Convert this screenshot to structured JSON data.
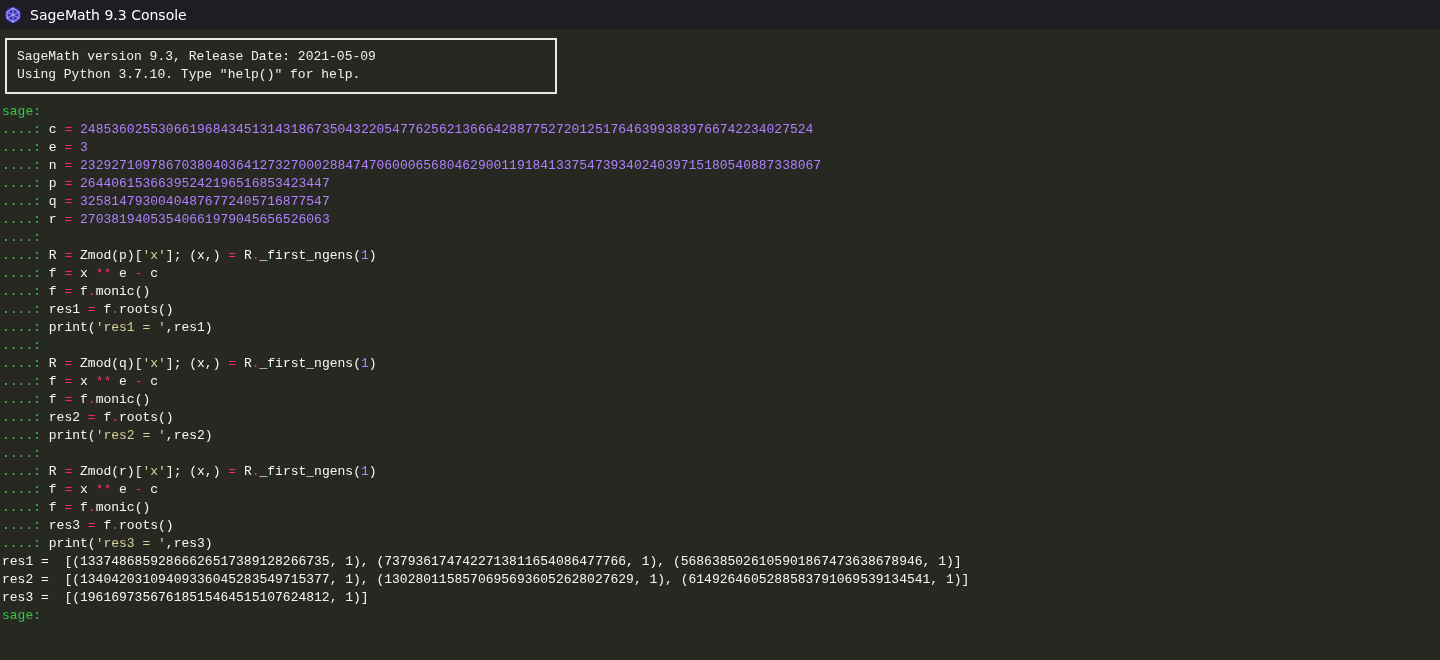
{
  "window": {
    "title": "SageMath 9.3 Console"
  },
  "banner": [
    "SageMath version 9.3, Release Date: 2021-05-09",
    "Using Python 3.7.10. Type \"help()\" for help."
  ],
  "lines": [
    {
      "kind": "input",
      "prompt": "sage:"
    },
    {
      "kind": "input",
      "prompt": "....:",
      "tokens": [
        {
          "kind": "id",
          "text": "c "
        },
        {
          "kind": "op",
          "text": "="
        },
        {
          "kind": "num",
          "text": " 2485360255306619684345131431867350432205477625621366642887752720125176463993839766742234027524"
        }
      ]
    },
    {
      "kind": "input",
      "prompt": "....:",
      "tokens": [
        {
          "kind": "id",
          "text": "e "
        },
        {
          "kind": "op",
          "text": "="
        },
        {
          "kind": "num",
          "text": " 3"
        }
      ]
    },
    {
      "kind": "input",
      "prompt": "....:",
      "tokens": [
        {
          "kind": "id",
          "text": "n "
        },
        {
          "kind": "op",
          "text": "="
        },
        {
          "kind": "num",
          "text": " 23292710978670380403641273270002884747060006568046290011918413375473934024039715180540887338067"
        }
      ]
    },
    {
      "kind": "input",
      "prompt": "....:",
      "tokens": [
        {
          "kind": "id",
          "text": "p "
        },
        {
          "kind": "op",
          "text": "="
        },
        {
          "kind": "num",
          "text": " 26440615366395242196516853423447"
        }
      ]
    },
    {
      "kind": "input",
      "prompt": "....:",
      "tokens": [
        {
          "kind": "id",
          "text": "q "
        },
        {
          "kind": "op",
          "text": "="
        },
        {
          "kind": "num",
          "text": " 32581479300404876772405716877547"
        }
      ]
    },
    {
      "kind": "input",
      "prompt": "....:",
      "tokens": [
        {
          "kind": "id",
          "text": "r "
        },
        {
          "kind": "op",
          "text": "="
        },
        {
          "kind": "num",
          "text": " 27038194053540661979045656526063"
        }
      ]
    },
    {
      "kind": "input",
      "prompt": "....:"
    },
    {
      "kind": "input",
      "prompt": "....:",
      "tokens": [
        {
          "kind": "id",
          "text": "R "
        },
        {
          "kind": "op",
          "text": "="
        },
        {
          "kind": "id",
          "text": " Zmod(p)["
        },
        {
          "kind": "str",
          "text": "'x'"
        },
        {
          "kind": "id",
          "text": "]; (x,) "
        },
        {
          "kind": "op",
          "text": "="
        },
        {
          "kind": "id",
          "text": " R"
        },
        {
          "kind": "op",
          "text": "."
        },
        {
          "kind": "id",
          "text": "_first_ngens("
        },
        {
          "kind": "num",
          "text": "1"
        },
        {
          "kind": "id",
          "text": ")"
        }
      ]
    },
    {
      "kind": "input",
      "prompt": "....:",
      "tokens": [
        {
          "kind": "id",
          "text": "f "
        },
        {
          "kind": "op",
          "text": "="
        },
        {
          "kind": "id",
          "text": " x "
        },
        {
          "kind": "op",
          "text": "**"
        },
        {
          "kind": "id",
          "text": " e "
        },
        {
          "kind": "op",
          "text": "-"
        },
        {
          "kind": "id",
          "text": " c"
        }
      ]
    },
    {
      "kind": "input",
      "prompt": "....:",
      "tokens": [
        {
          "kind": "id",
          "text": "f "
        },
        {
          "kind": "op",
          "text": "="
        },
        {
          "kind": "id",
          "text": " f"
        },
        {
          "kind": "op",
          "text": "."
        },
        {
          "kind": "id",
          "text": "monic()"
        }
      ]
    },
    {
      "kind": "input",
      "prompt": "....:",
      "tokens": [
        {
          "kind": "id",
          "text": "res1 "
        },
        {
          "kind": "op",
          "text": "="
        },
        {
          "kind": "id",
          "text": " f"
        },
        {
          "kind": "op",
          "text": "."
        },
        {
          "kind": "id",
          "text": "roots()"
        }
      ]
    },
    {
      "kind": "input",
      "prompt": "....:",
      "tokens": [
        {
          "kind": "id",
          "text": "print("
        },
        {
          "kind": "str",
          "text": "'res1 = '"
        },
        {
          "kind": "id",
          "text": ",res1)"
        }
      ]
    },
    {
      "kind": "input",
      "prompt": "....:"
    },
    {
      "kind": "input",
      "prompt": "....:",
      "tokens": [
        {
          "kind": "id",
          "text": "R "
        },
        {
          "kind": "op",
          "text": "="
        },
        {
          "kind": "id",
          "text": " Zmod(q)["
        },
        {
          "kind": "str",
          "text": "'x'"
        },
        {
          "kind": "id",
          "text": "]; (x,) "
        },
        {
          "kind": "op",
          "text": "="
        },
        {
          "kind": "id",
          "text": " R"
        },
        {
          "kind": "op",
          "text": "."
        },
        {
          "kind": "id",
          "text": "_first_ngens("
        },
        {
          "kind": "num",
          "text": "1"
        },
        {
          "kind": "id",
          "text": ")"
        }
      ]
    },
    {
      "kind": "input",
      "prompt": "....:",
      "tokens": [
        {
          "kind": "id",
          "text": "f "
        },
        {
          "kind": "op",
          "text": "="
        },
        {
          "kind": "id",
          "text": " x "
        },
        {
          "kind": "op",
          "text": "**"
        },
        {
          "kind": "id",
          "text": " e "
        },
        {
          "kind": "op",
          "text": "-"
        },
        {
          "kind": "id",
          "text": " c"
        }
      ]
    },
    {
      "kind": "input",
      "prompt": "....:",
      "tokens": [
        {
          "kind": "id",
          "text": "f "
        },
        {
          "kind": "op",
          "text": "="
        },
        {
          "kind": "id",
          "text": " f"
        },
        {
          "kind": "op",
          "text": "."
        },
        {
          "kind": "id",
          "text": "monic()"
        }
      ]
    },
    {
      "kind": "input",
      "prompt": "....:",
      "tokens": [
        {
          "kind": "id",
          "text": "res2 "
        },
        {
          "kind": "op",
          "text": "="
        },
        {
          "kind": "id",
          "text": " f"
        },
        {
          "kind": "op",
          "text": "."
        },
        {
          "kind": "id",
          "text": "roots()"
        }
      ]
    },
    {
      "kind": "input",
      "prompt": "....:",
      "tokens": [
        {
          "kind": "id",
          "text": "print("
        },
        {
          "kind": "str",
          "text": "'res2 = '"
        },
        {
          "kind": "id",
          "text": ",res2)"
        }
      ]
    },
    {
      "kind": "input",
      "prompt": "....:"
    },
    {
      "kind": "input",
      "prompt": "....:",
      "tokens": [
        {
          "kind": "id",
          "text": "R "
        },
        {
          "kind": "op",
          "text": "="
        },
        {
          "kind": "id",
          "text": " Zmod(r)["
        },
        {
          "kind": "str",
          "text": "'x'"
        },
        {
          "kind": "id",
          "text": "]; (x,) "
        },
        {
          "kind": "op",
          "text": "="
        },
        {
          "kind": "id",
          "text": " R"
        },
        {
          "kind": "op",
          "text": "."
        },
        {
          "kind": "id",
          "text": "_first_ngens("
        },
        {
          "kind": "num",
          "text": "1"
        },
        {
          "kind": "id",
          "text": ")"
        }
      ]
    },
    {
      "kind": "input",
      "prompt": "....:",
      "tokens": [
        {
          "kind": "id",
          "text": "f "
        },
        {
          "kind": "op",
          "text": "="
        },
        {
          "kind": "id",
          "text": " x "
        },
        {
          "kind": "op",
          "text": "**"
        },
        {
          "kind": "id",
          "text": " e "
        },
        {
          "kind": "op",
          "text": "-"
        },
        {
          "kind": "id",
          "text": " c"
        }
      ]
    },
    {
      "kind": "input",
      "prompt": "....:",
      "tokens": [
        {
          "kind": "id",
          "text": "f "
        },
        {
          "kind": "op",
          "text": "="
        },
        {
          "kind": "id",
          "text": " f"
        },
        {
          "kind": "op",
          "text": "."
        },
        {
          "kind": "id",
          "text": "monic()"
        }
      ]
    },
    {
      "kind": "input",
      "prompt": "....:",
      "tokens": [
        {
          "kind": "id",
          "text": "res3 "
        },
        {
          "kind": "op",
          "text": "="
        },
        {
          "kind": "id",
          "text": " f"
        },
        {
          "kind": "op",
          "text": "."
        },
        {
          "kind": "id",
          "text": "roots()"
        }
      ]
    },
    {
      "kind": "input",
      "prompt": "....:",
      "tokens": [
        {
          "kind": "id",
          "text": "print("
        },
        {
          "kind": "str",
          "text": "'res3 = '"
        },
        {
          "kind": "id",
          "text": ",res3)"
        }
      ]
    },
    {
      "kind": "output",
      "text": "res1 =  [(13374868592866626517389128266735, 1), (7379361747422713811654086477766, 1), (5686385026105901867473638678946, 1)]"
    },
    {
      "kind": "output",
      "text": "res2 =  [(13404203109409336045283549715377, 1), (13028011585706956936052628027629, 1), (6149264605288583791069539134541, 1)]"
    },
    {
      "kind": "output",
      "text": "res3 =  [(19616973567618515464515107624812, 1)]"
    },
    {
      "kind": "input",
      "prompt": "sage:"
    }
  ]
}
